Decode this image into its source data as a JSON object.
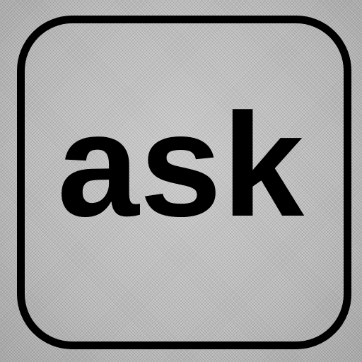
{
  "icon": {
    "label": "ask",
    "frame_color": "#000000",
    "text_color": "#000000",
    "background_color": "#c4c4c4",
    "background_texture": "woven-fabric"
  }
}
